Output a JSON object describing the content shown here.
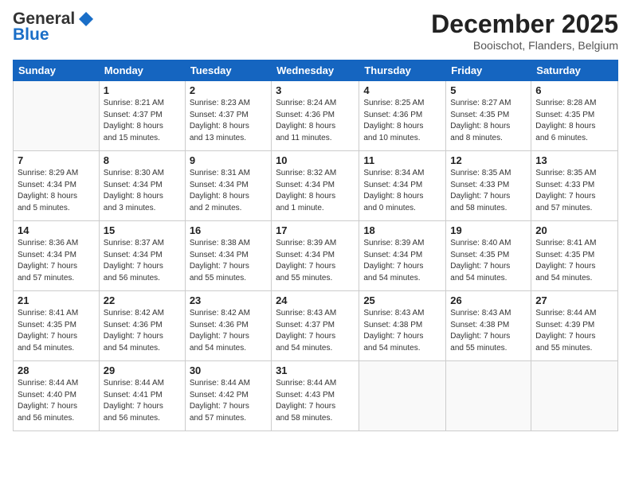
{
  "header": {
    "logo_general": "General",
    "logo_blue": "Blue",
    "month": "December 2025",
    "location": "Booischot, Flanders, Belgium"
  },
  "weekdays": [
    "Sunday",
    "Monday",
    "Tuesday",
    "Wednesday",
    "Thursday",
    "Friday",
    "Saturday"
  ],
  "weeks": [
    [
      {
        "day": "",
        "info": ""
      },
      {
        "day": "1",
        "info": "Sunrise: 8:21 AM\nSunset: 4:37 PM\nDaylight: 8 hours\nand 15 minutes."
      },
      {
        "day": "2",
        "info": "Sunrise: 8:23 AM\nSunset: 4:37 PM\nDaylight: 8 hours\nand 13 minutes."
      },
      {
        "day": "3",
        "info": "Sunrise: 8:24 AM\nSunset: 4:36 PM\nDaylight: 8 hours\nand 11 minutes."
      },
      {
        "day": "4",
        "info": "Sunrise: 8:25 AM\nSunset: 4:36 PM\nDaylight: 8 hours\nand 10 minutes."
      },
      {
        "day": "5",
        "info": "Sunrise: 8:27 AM\nSunset: 4:35 PM\nDaylight: 8 hours\nand 8 minutes."
      },
      {
        "day": "6",
        "info": "Sunrise: 8:28 AM\nSunset: 4:35 PM\nDaylight: 8 hours\nand 6 minutes."
      }
    ],
    [
      {
        "day": "7",
        "info": "Sunrise: 8:29 AM\nSunset: 4:34 PM\nDaylight: 8 hours\nand 5 minutes."
      },
      {
        "day": "8",
        "info": "Sunrise: 8:30 AM\nSunset: 4:34 PM\nDaylight: 8 hours\nand 3 minutes."
      },
      {
        "day": "9",
        "info": "Sunrise: 8:31 AM\nSunset: 4:34 PM\nDaylight: 8 hours\nand 2 minutes."
      },
      {
        "day": "10",
        "info": "Sunrise: 8:32 AM\nSunset: 4:34 PM\nDaylight: 8 hours\nand 1 minute."
      },
      {
        "day": "11",
        "info": "Sunrise: 8:34 AM\nSunset: 4:34 PM\nDaylight: 8 hours\nand 0 minutes."
      },
      {
        "day": "12",
        "info": "Sunrise: 8:35 AM\nSunset: 4:33 PM\nDaylight: 7 hours\nand 58 minutes."
      },
      {
        "day": "13",
        "info": "Sunrise: 8:35 AM\nSunset: 4:33 PM\nDaylight: 7 hours\nand 57 minutes."
      }
    ],
    [
      {
        "day": "14",
        "info": "Sunrise: 8:36 AM\nSunset: 4:34 PM\nDaylight: 7 hours\nand 57 minutes."
      },
      {
        "day": "15",
        "info": "Sunrise: 8:37 AM\nSunset: 4:34 PM\nDaylight: 7 hours\nand 56 minutes."
      },
      {
        "day": "16",
        "info": "Sunrise: 8:38 AM\nSunset: 4:34 PM\nDaylight: 7 hours\nand 55 minutes."
      },
      {
        "day": "17",
        "info": "Sunrise: 8:39 AM\nSunset: 4:34 PM\nDaylight: 7 hours\nand 55 minutes."
      },
      {
        "day": "18",
        "info": "Sunrise: 8:39 AM\nSunset: 4:34 PM\nDaylight: 7 hours\nand 54 minutes."
      },
      {
        "day": "19",
        "info": "Sunrise: 8:40 AM\nSunset: 4:35 PM\nDaylight: 7 hours\nand 54 minutes."
      },
      {
        "day": "20",
        "info": "Sunrise: 8:41 AM\nSunset: 4:35 PM\nDaylight: 7 hours\nand 54 minutes."
      }
    ],
    [
      {
        "day": "21",
        "info": "Sunrise: 8:41 AM\nSunset: 4:35 PM\nDaylight: 7 hours\nand 54 minutes."
      },
      {
        "day": "22",
        "info": "Sunrise: 8:42 AM\nSunset: 4:36 PM\nDaylight: 7 hours\nand 54 minutes."
      },
      {
        "day": "23",
        "info": "Sunrise: 8:42 AM\nSunset: 4:36 PM\nDaylight: 7 hours\nand 54 minutes."
      },
      {
        "day": "24",
        "info": "Sunrise: 8:43 AM\nSunset: 4:37 PM\nDaylight: 7 hours\nand 54 minutes."
      },
      {
        "day": "25",
        "info": "Sunrise: 8:43 AM\nSunset: 4:38 PM\nDaylight: 7 hours\nand 54 minutes."
      },
      {
        "day": "26",
        "info": "Sunrise: 8:43 AM\nSunset: 4:38 PM\nDaylight: 7 hours\nand 55 minutes."
      },
      {
        "day": "27",
        "info": "Sunrise: 8:44 AM\nSunset: 4:39 PM\nDaylight: 7 hours\nand 55 minutes."
      }
    ],
    [
      {
        "day": "28",
        "info": "Sunrise: 8:44 AM\nSunset: 4:40 PM\nDaylight: 7 hours\nand 56 minutes."
      },
      {
        "day": "29",
        "info": "Sunrise: 8:44 AM\nSunset: 4:41 PM\nDaylight: 7 hours\nand 56 minutes."
      },
      {
        "day": "30",
        "info": "Sunrise: 8:44 AM\nSunset: 4:42 PM\nDaylight: 7 hours\nand 57 minutes."
      },
      {
        "day": "31",
        "info": "Sunrise: 8:44 AM\nSunset: 4:43 PM\nDaylight: 7 hours\nand 58 minutes."
      },
      {
        "day": "",
        "info": ""
      },
      {
        "day": "",
        "info": ""
      },
      {
        "day": "",
        "info": ""
      }
    ]
  ]
}
